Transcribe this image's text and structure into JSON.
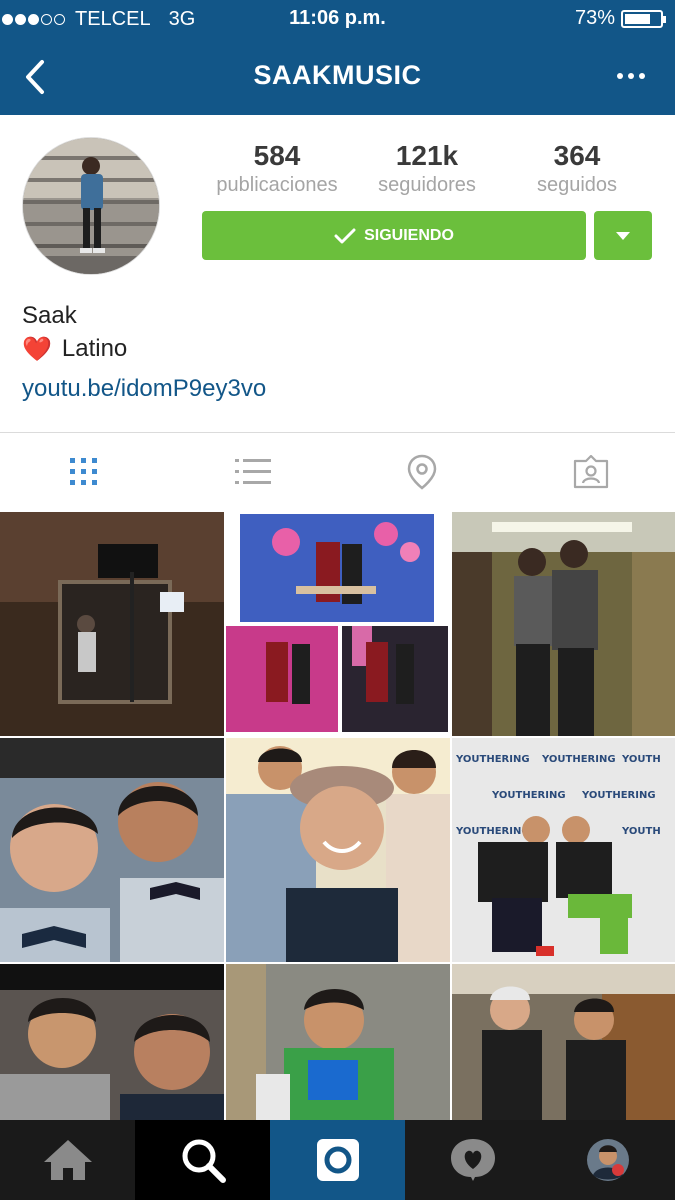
{
  "status_bar": {
    "carrier": "TELCEL",
    "network": "3G",
    "time": "11:06 p.m.",
    "battery": "73%",
    "battery_level": 0.73,
    "signal_bars": 3
  },
  "nav": {
    "title": "SAAKMUSIC",
    "back_icon": "chevron-left-icon",
    "more_icon": "more-dots-icon"
  },
  "profile": {
    "stats": [
      {
        "value": "584",
        "label": "publicaciones"
      },
      {
        "value": "121k",
        "label": "seguidores"
      },
      {
        "value": "364",
        "label": "seguidos"
      }
    ],
    "follow_button": "SIGUIENDO",
    "name": "Saak",
    "bio_emoji": "❤️",
    "bio": "Latino",
    "link": "youtu.be/idomP9ey3vo"
  },
  "tabs": [
    {
      "icon": "grid-icon",
      "active": true
    },
    {
      "icon": "list-icon",
      "active": false
    },
    {
      "icon": "location-icon",
      "active": false
    },
    {
      "icon": "tagged-photos-icon",
      "active": false
    }
  ],
  "bottom_bar": [
    {
      "icon": "home-icon",
      "active": false
    },
    {
      "icon": "search-icon",
      "active": true
    },
    {
      "icon": "camera-icon",
      "active": false
    },
    {
      "icon": "activity-heart-icon",
      "active": false
    },
    {
      "icon": "profile-avatar-icon",
      "active": false
    }
  ],
  "colors": {
    "brand": "#125688",
    "follow_green": "#6bbf3c",
    "tab_active": "#3d8ad0",
    "tab_inactive": "#a8a8a8",
    "tabbar_bg": "#1a1a1a"
  }
}
